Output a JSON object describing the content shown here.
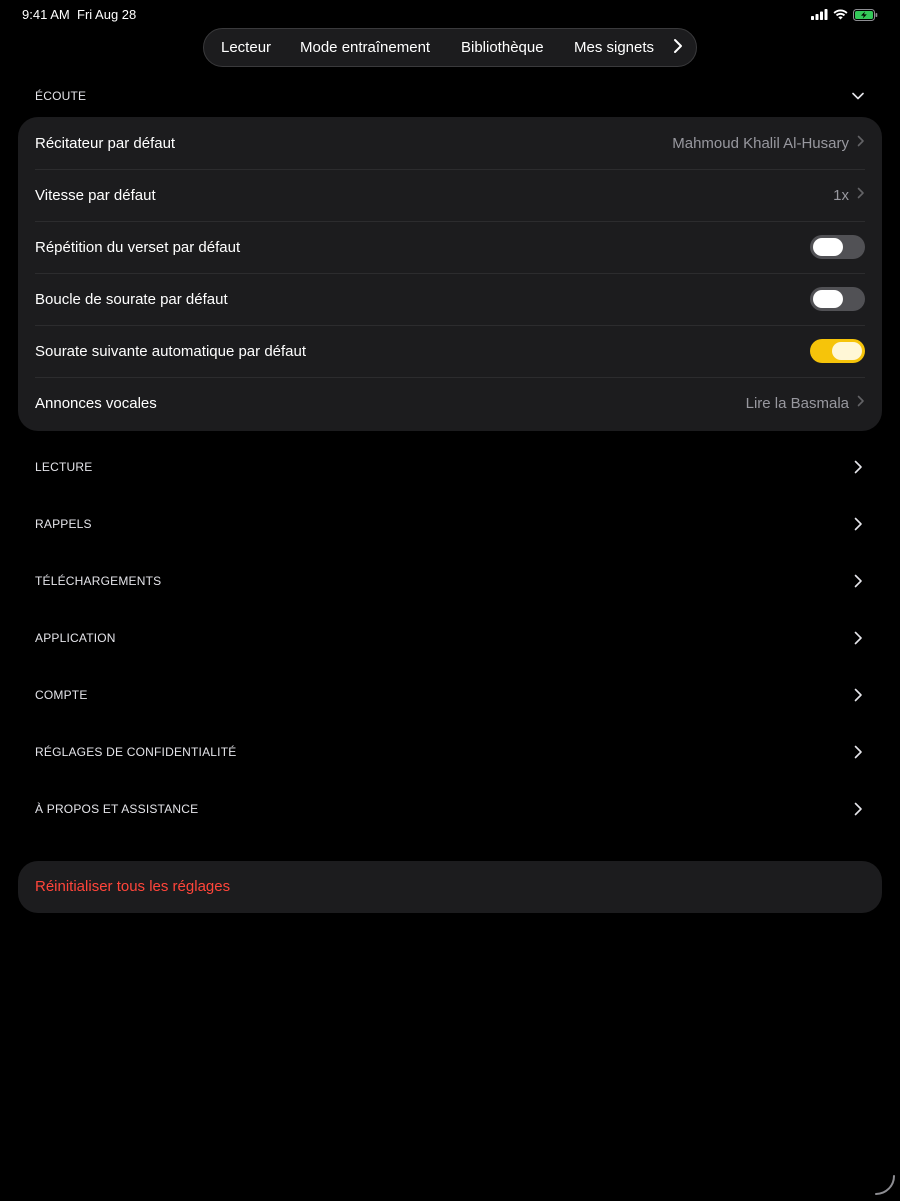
{
  "status_bar": {
    "time": "9:41 AM",
    "date": "Fri Aug 28",
    "icons": [
      "cellular-signal-icon",
      "wifi-icon",
      "battery-charging-icon"
    ],
    "battery_color": "#34c759"
  },
  "tabs": {
    "items": [
      {
        "label": "Lecteur"
      },
      {
        "label": "Mode entraînement"
      },
      {
        "label": "Bibliothèque"
      },
      {
        "label": "Mes signets"
      }
    ],
    "more_icon": "chevron-right-icon"
  },
  "listening": {
    "header": "ÉCOUTE",
    "expand_icon": "chevron-down-icon",
    "rows": [
      {
        "title": "Récitateur par défaut",
        "value": "Mahmoud Khalil Al-Husary",
        "type": "disclosure"
      },
      {
        "title": "Vitesse par défaut",
        "value": "1x",
        "type": "disclosure"
      },
      {
        "title": "Répétition du verset par défaut",
        "type": "toggle",
        "on": false
      },
      {
        "title": "Boucle de sourate par défaut",
        "type": "toggle",
        "on": false
      },
      {
        "title": "Sourate suivante automatique par défaut",
        "type": "toggle",
        "on": true
      },
      {
        "title": "Annonces vocales",
        "value": "Lire la Basmala",
        "type": "disclosure"
      }
    ]
  },
  "sections": [
    {
      "label": "LECTURE"
    },
    {
      "label": "RAPPELS"
    },
    {
      "label": "TÉLÉCHARGEMENTS"
    },
    {
      "label": "APPLICATION"
    },
    {
      "label": "COMPTE"
    },
    {
      "label": "RÉGLAGES DE CONFIDENTIALITÉ"
    },
    {
      "label": "À PROPOS ET ASSISTANCE"
    }
  ],
  "reset": {
    "label": "Réinitialiser tous les réglages",
    "color": "#ff453a"
  },
  "colors": {
    "accent_toggle": "#f6c40a",
    "background": "#000000",
    "card": "#1c1c1e"
  }
}
